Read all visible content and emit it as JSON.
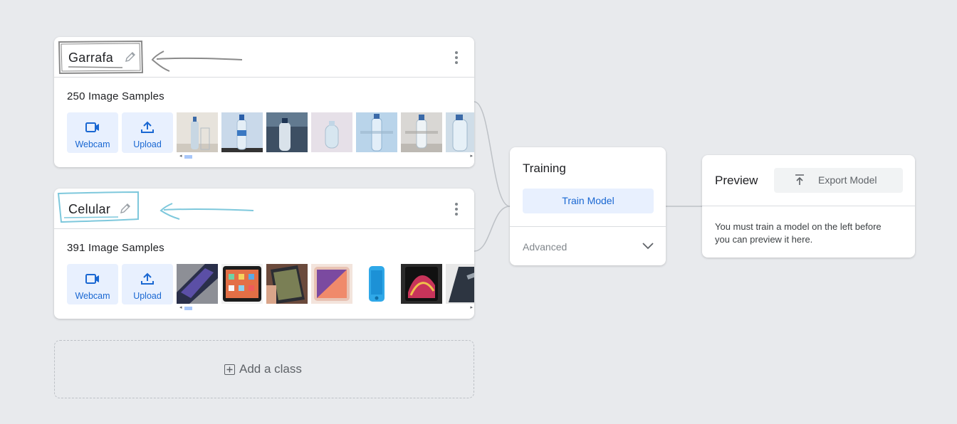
{
  "classes": [
    {
      "name": "Garrafa",
      "samples_label": "250 Image Samples",
      "webcam_label": "Webcam",
      "upload_label": "Upload",
      "annotation_color": "#8a8a8a"
    },
    {
      "name": "Celular",
      "samples_label": "391 Image Samples",
      "webcam_label": "Webcam",
      "upload_label": "Upload",
      "annotation_color": "#7ec8dc"
    }
  ],
  "add_class": {
    "label": "Add a class"
  },
  "training": {
    "title": "Training",
    "train_button": "Train Model",
    "advanced_label": "Advanced"
  },
  "preview": {
    "title": "Preview",
    "export_button": "Export Model",
    "message": "You must train a model on the left before you can preview it here."
  },
  "colors": {
    "accent": "#1967d2",
    "accent_bg": "#e8f0fe",
    "background": "#e8eaed"
  },
  "icons": [
    "pencil-icon",
    "more-vert-icon",
    "webcam-icon",
    "upload-icon",
    "add-box-icon",
    "chevron-down-icon",
    "export-icon"
  ]
}
